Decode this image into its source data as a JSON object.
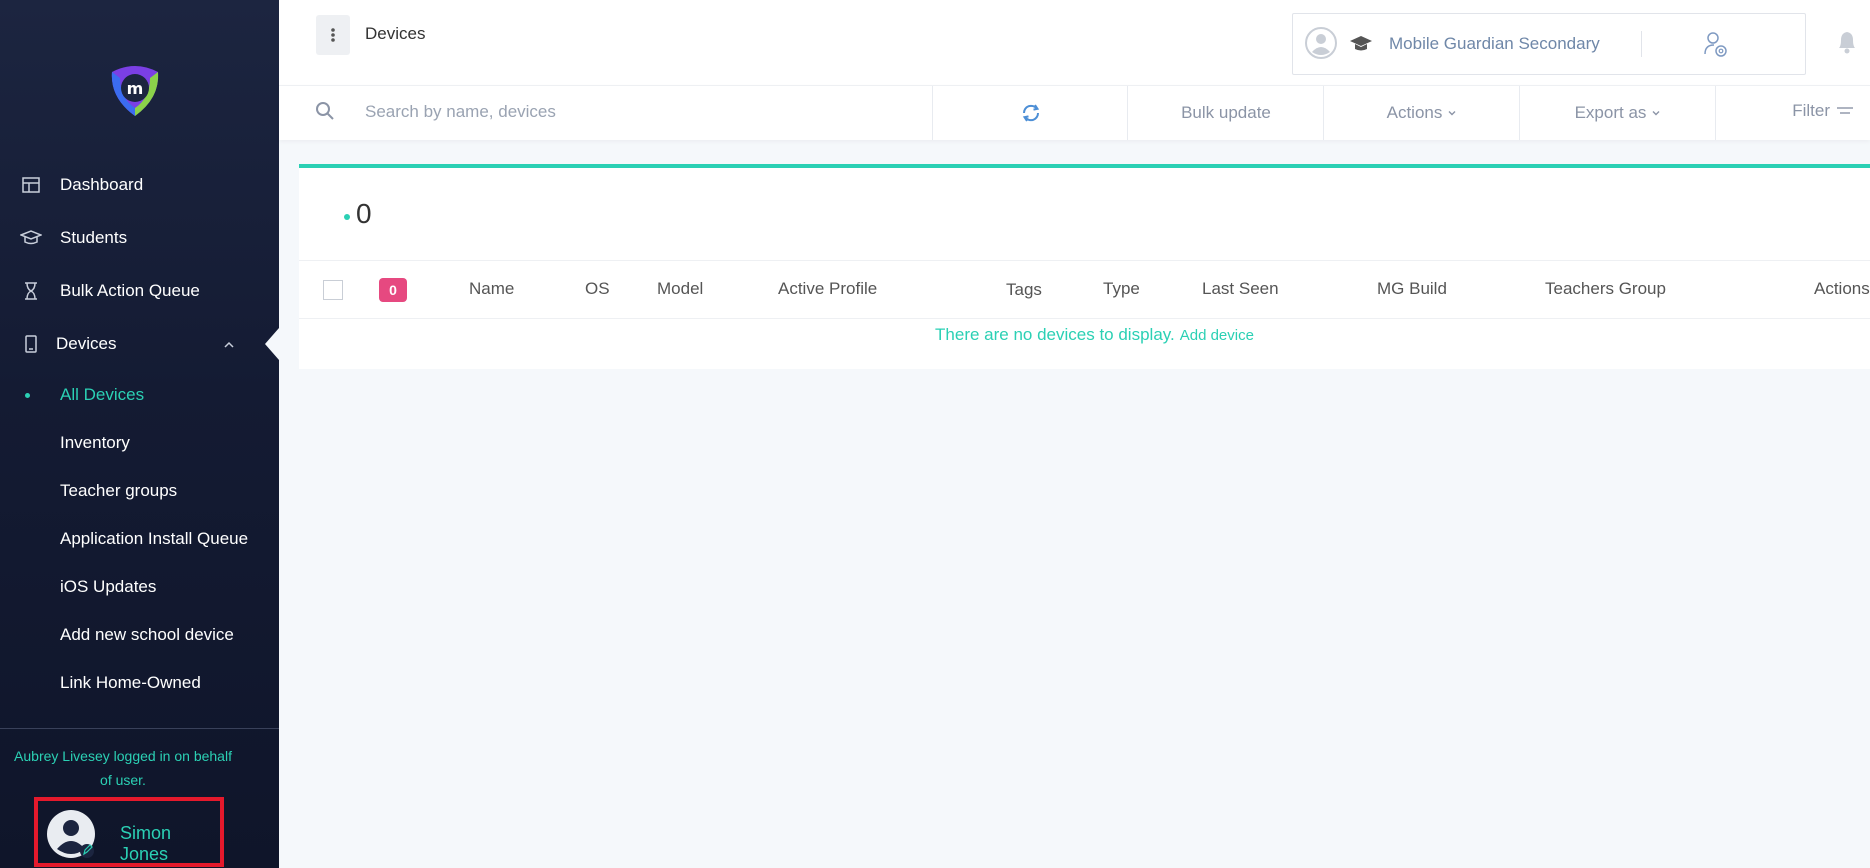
{
  "colors": {
    "accent": "#2bd0b4",
    "sidebar_bg": "#141b33",
    "badge": "#e64980",
    "highlight_box": "#e5192c",
    "muted_text": "#8b94a6"
  },
  "sidebar": {
    "logo_icon": "mobile-guardian-logo",
    "nav": [
      {
        "label": "Dashboard",
        "icon": "dashboard-icon"
      },
      {
        "label": "Students",
        "icon": "graduation-cap-icon"
      },
      {
        "label": "Bulk Action Queue",
        "icon": "hourglass-icon"
      },
      {
        "label": "Devices",
        "icon": "phone-icon",
        "expanded": true
      }
    ],
    "devices_submenu": [
      {
        "label": "All Devices",
        "active": true
      },
      {
        "label": "Inventory"
      },
      {
        "label": "Teacher groups"
      },
      {
        "label": "Application Install Queue"
      },
      {
        "label": "iOS Updates"
      },
      {
        "label": "Add new school device"
      },
      {
        "label": "Link Home-Owned"
      }
    ],
    "impersonation_line1": "Aubrey Livesey logged in on behalf",
    "impersonation_line2": "of user.",
    "user_name": "Simon Jones"
  },
  "header": {
    "page_title": "Devices",
    "org_name": "Mobile Guardian Secondary"
  },
  "toolbar": {
    "search_placeholder": "Search by name, devices",
    "bulk_update": "Bulk update",
    "actions": "Actions",
    "export_as": "Export as",
    "filter": "Filter"
  },
  "devices_table": {
    "count": "0",
    "badge_count": "0",
    "columns": [
      "Name",
      "OS",
      "Model",
      "Active Profile",
      "Tags",
      "Type",
      "Last Seen",
      "MG Build",
      "Teachers Group",
      "Actions"
    ],
    "empty_message": "There are no devices to display.",
    "add_device_link": "Add device"
  }
}
